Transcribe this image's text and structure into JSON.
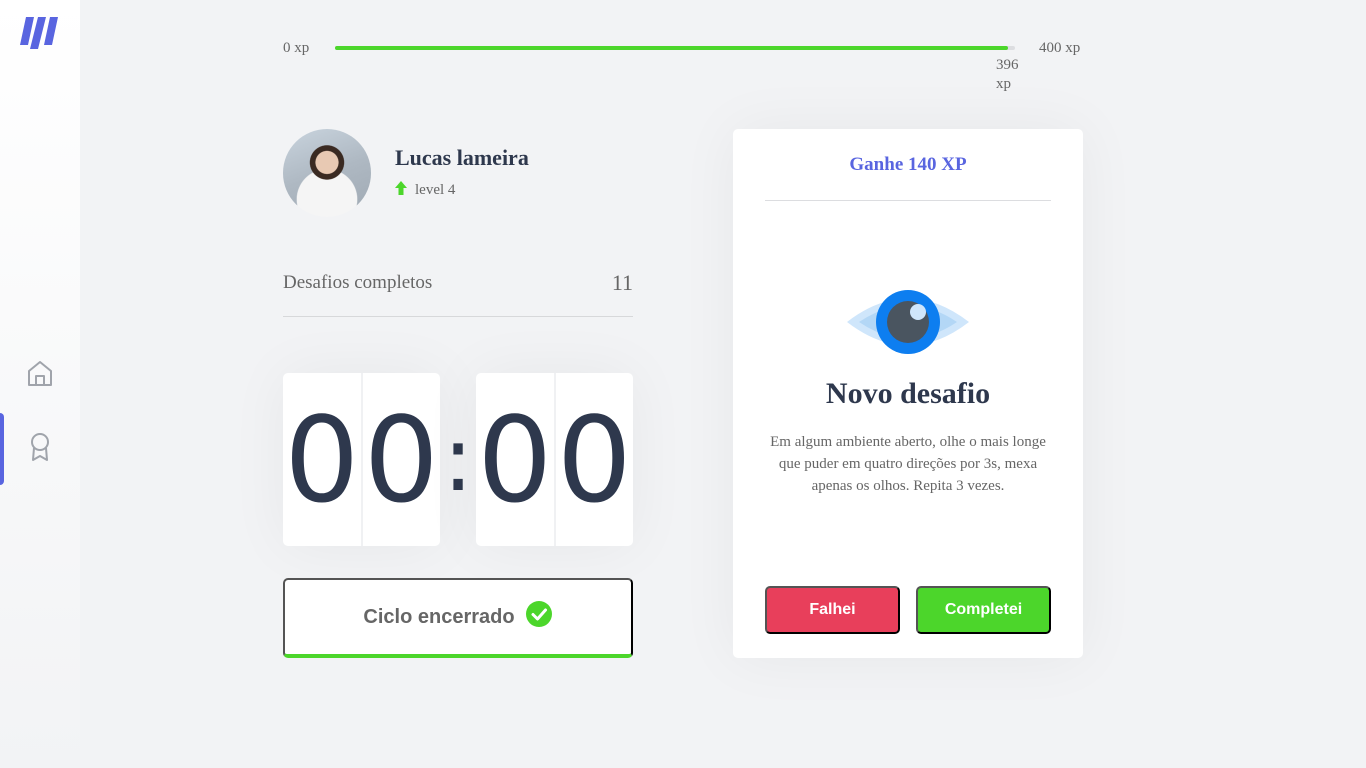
{
  "sidebar": {
    "logo_icon": "logo-icon",
    "items": [
      {
        "icon": "home-icon",
        "active": false
      },
      {
        "icon": "award-icon",
        "active": true
      }
    ],
    "accent_color": "#5965e0"
  },
  "xp": {
    "start_label": "0 xp",
    "end_label": "400 xp",
    "current_label": "396 xp",
    "current": 396,
    "max": 400
  },
  "profile": {
    "name": "Lucas lameira",
    "level_label": "level 4",
    "level_icon": "level-up-icon"
  },
  "stats": {
    "completed_label": "Desafios completos",
    "completed_value": "11"
  },
  "countdown": {
    "minutes": [
      "0",
      "0"
    ],
    "separator": ":",
    "seconds": [
      "0",
      "0"
    ]
  },
  "cycle_button": {
    "label": "Ciclo encerrado",
    "icon": "check-circle-icon"
  },
  "challenge": {
    "header": "Ganhe 140 XP",
    "icon": "eye-icon",
    "title": "Novo desafio",
    "description": "Em algum ambiente aberto, olhe o mais longe que puder em quatro direções por 3s, mexa apenas os olhos. Repita 3 vezes.",
    "fail_label": "Falhei",
    "success_label": "Completei"
  },
  "colors": {
    "green": "#4cd62b",
    "red": "#e83f5b",
    "blue": "#5965e0",
    "title": "#2e384d",
    "text": "#666666"
  }
}
